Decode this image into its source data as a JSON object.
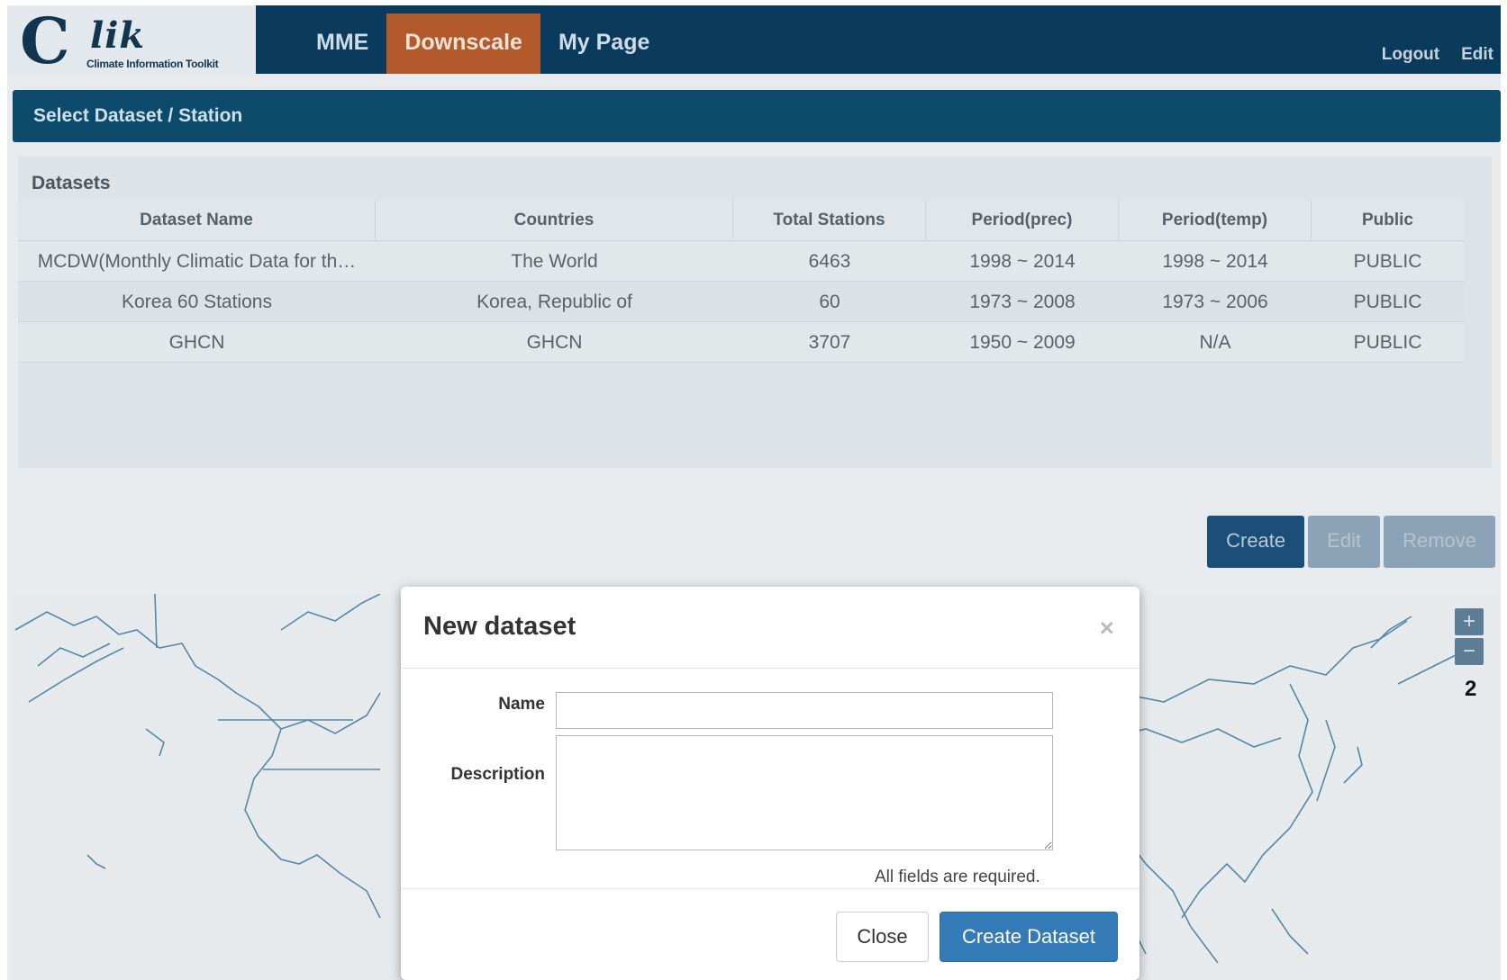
{
  "header": {
    "logo_letter": "C",
    "logo_word": "lik",
    "logo_subtitle": "Climate Information Toolkit",
    "nav": [
      {
        "label": "MME"
      },
      {
        "label": "Downscale"
      },
      {
        "label": "My Page"
      }
    ],
    "active_nav": "Downscale",
    "logout_label": "Logout",
    "edit_label": "Edit"
  },
  "section": {
    "title": "Select Dataset / Station"
  },
  "datasets": {
    "title": "Datasets",
    "columns": [
      "Dataset Name",
      "Countries",
      "Total Stations",
      "Period(prec)",
      "Period(temp)",
      "Public"
    ],
    "rows": [
      [
        "MCDW(Monthly Climatic Data for th…",
        "The World",
        "6463",
        "1998 ~ 2014",
        "1998 ~ 2014",
        "PUBLIC"
      ],
      [
        "Korea 60 Stations",
        "Korea, Republic of",
        "60",
        "1973 ~ 2008",
        "1973 ~ 2006",
        "PUBLIC"
      ],
      [
        "GHCN",
        "GHCN",
        "3707",
        "1950 ~ 2009",
        "N/A",
        "PUBLIC"
      ]
    ]
  },
  "actions": {
    "create_label": "Create",
    "edit_label": "Edit",
    "remove_label": "Remove"
  },
  "map": {
    "zoom_in": "+",
    "zoom_out": "−",
    "zoom_level": "2"
  },
  "modal": {
    "title": "New dataset",
    "close_glyph": "×",
    "name_label": "Name",
    "name_value": "",
    "description_label": "Description",
    "description_value": "",
    "note": "All fields are required.",
    "close_label": "Close",
    "submit_label": "Create Dataset"
  },
  "colors": {
    "topbar": "#0a3a5c",
    "active_nav": "#b35a2c",
    "section_header": "#0c4b6b",
    "primary_button": "#337ab7"
  }
}
